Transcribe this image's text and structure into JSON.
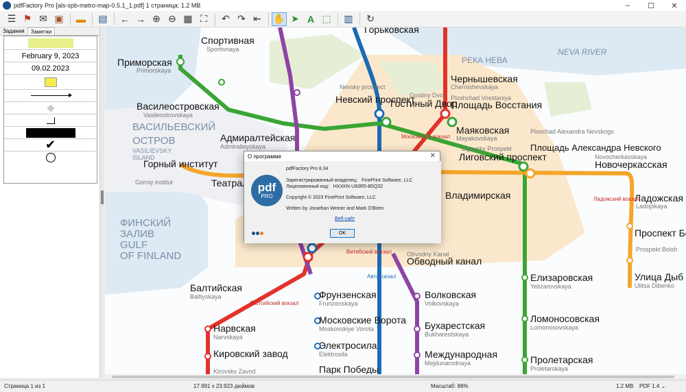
{
  "window": {
    "title": "pdfFactory Pro [als-spb-metro-map-0.5.1_1.pdf] 1 страница; 1.2 MB",
    "controls": [
      "–",
      "☐",
      "✕"
    ]
  },
  "toolbar": {
    "icons": [
      "menu-icon",
      "pdf-icon",
      "email-icon",
      "save-icon",
      "open-folder-icon",
      "print-icon",
      "back-icon",
      "forward-icon",
      "zoom-in-icon",
      "zoom-out-icon",
      "grid-icon",
      "fit-page-icon",
      "undo-icon",
      "redo-icon",
      "undo-all-icon",
      "hand-icon",
      "select-icon",
      "text-icon",
      "crop-icon",
      "notes-icon",
      "refresh-icon"
    ]
  },
  "left_panel": {
    "tabs": [
      "Задания",
      "Заметки"
    ],
    "active_tab": "Заметки",
    "notes": [
      "February 9, 2023",
      "09.02.2023"
    ]
  },
  "dialog": {
    "title": "О программе",
    "close": "✕",
    "logo_top": "pdf",
    "logo_bottom": "PRO",
    "product": "pdfFactory Pro 8.34",
    "owner_label": "Зарегистрированный владелец:",
    "owner_value": "FinePrint Software, LLC",
    "license_label": "Лицензионный код:",
    "license_value": "HXXKN-U83R5-B5Q32",
    "copyright": "Copyright © 2023 FinePrint Software, LLC",
    "authors": "Written by Jonathan Weiner and Mark O'Brien",
    "website": "Веб-сайт",
    "ok": "OK"
  },
  "map": {
    "water": [
      "РЕКА НЕВА",
      "NEVA RIVER",
      "ФИНСКИЙ",
      "ЗАЛИВ",
      "GULF",
      "OF FINLAND",
      "ВАСИЛЬЕВСКИЙ",
      "ОСТРОВ",
      "VASILIEVSKY",
      "ISLAND"
    ],
    "stations": [
      {
        "ru": "Спортивная",
        "en": "Sportivnaya"
      },
      {
        "ru": "Горьковская",
        "en": ""
      },
      {
        "ru": "Приморская",
        "en": "Primorskaya"
      },
      {
        "ru": "Василеостровская",
        "en": "Vasileostrovskaya"
      },
      {
        "ru": "Адмиралтейская",
        "en": "Admiralteyskaya"
      },
      {
        "ru": "Невский проспект",
        "en": "Nevsky prospect"
      },
      {
        "ru": "Гостиный Двор",
        "en": "Gostiny Dvor"
      },
      {
        "ru": "Чернышевская",
        "en": "Chernishevskaya"
      },
      {
        "ru": "Площадь Восстания",
        "en": "Ploshchad Vosstaniya"
      },
      {
        "ru": "Маяковская",
        "en": "Mayakovskaya"
      },
      {
        "ru": "Лиговский проспект",
        "en": "Ligovsky Prospekt"
      },
      {
        "ru": "Площадь Александра Невского",
        "en": "Ploschad Alexandra Nevskogo"
      },
      {
        "ru": "Новочеркасская",
        "en": "Novocherkasskaya"
      },
      {
        "ru": "Горный институт",
        "en": "Gorniy institut"
      },
      {
        "ru": "Театральная",
        "en": ""
      },
      {
        "ru": "Владимирская",
        "en": ""
      },
      {
        "ru": "Ладожская",
        "en": "Ladojskaya"
      },
      {
        "ru": "Проспект Большевиков",
        "en": "Prospekt Bolsh"
      },
      {
        "ru": "Обводный канал",
        "en": "Obvodny Kanal"
      },
      {
        "ru": "Балтийская",
        "en": "Baltiyskaya"
      },
      {
        "ru": "Фрунзенская",
        "en": "Frunzenskaya"
      },
      {
        "ru": "Волковская",
        "en": "Volkovskaya"
      },
      {
        "ru": "Елизаровская",
        "en": "Yelizarovskaya"
      },
      {
        "ru": "Нарвская",
        "en": "Narvskaya"
      },
      {
        "ru": "Московские Ворота",
        "en": "Moskovskiye Vorota"
      },
      {
        "ru": "Бухарестская",
        "en": "Bukharestskaya"
      },
      {
        "ru": "Ломоносовская",
        "en": "Lomonosovskaya"
      },
      {
        "ru": "Электросила",
        "en": "Elektrosila"
      },
      {
        "ru": "Кировский завод",
        "en": "Kirovsky Zavod"
      },
      {
        "ru": "Международная",
        "en": "Mejdunarodnaya"
      },
      {
        "ru": "Парк Победы",
        "en": ""
      },
      {
        "ru": "Пролетарская",
        "en": "Proletarskaya"
      },
      {
        "ru": "Улица Дыб",
        "en": "Ulitsa Dibenko"
      }
    ],
    "rail": [
      "Ладожский вокзал",
      "Балтийский вокзал",
      "Витебский вокзал",
      "Московский вокзал",
      "Автовокзал"
    ],
    "line_colors": {
      "red": "#e4312b",
      "blue": "#1d6ab5",
      "green": "#3aa534",
      "orange": "#f4a52a",
      "purple": "#8e44a4"
    }
  },
  "statusbar": {
    "page": "Страница 1 из 1",
    "size": "17.991 x 23.923 дюймов",
    "zoom": "Масштаб: 88%",
    "filesize": "1.2 MB",
    "pdfver": "PDF 1.4 ⌄"
  }
}
